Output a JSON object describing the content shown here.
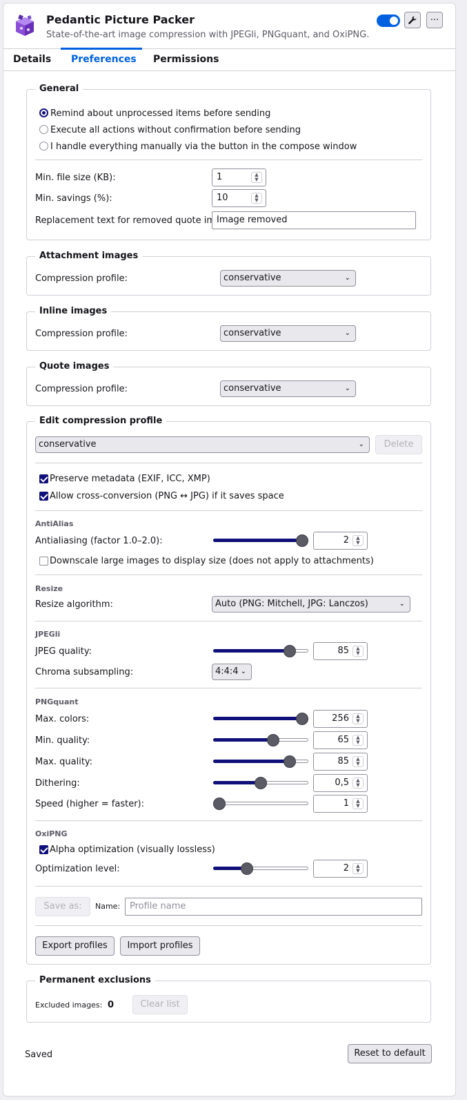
{
  "header": {
    "title": "Pedantic Picture Packer",
    "description": "State-of-the-art image compression with JPEGli, PNGquant, and OxiPNG.",
    "enabled": true,
    "settings_icon": "wrench-icon",
    "more_icon": "ellipsis-icon",
    "more_label": "···"
  },
  "tabs": [
    {
      "label": "Details"
    },
    {
      "label": "Preferences",
      "active": true
    },
    {
      "label": "Permissions"
    }
  ],
  "general": {
    "legend": "General",
    "options": [
      {
        "label": "Remind about unprocessed items before sending",
        "selected": true
      },
      {
        "label": "Execute all actions without confirmation before sending",
        "selected": false
      },
      {
        "label": "I handle everything manually via the button in the compose window",
        "selected": false
      }
    ],
    "min_file_size_label": "Min. file size (KB):",
    "min_file_size": "1",
    "min_savings_label": "Min. savings (%):",
    "min_savings": "10",
    "replacement_label": "Replacement text for removed quote images:",
    "replacement_text": "Image removed"
  },
  "attachment": {
    "legend": "Attachment images",
    "label": "Compression profile:",
    "value": "conservative"
  },
  "inline": {
    "legend": "Inline images",
    "label": "Compression profile:",
    "value": "conservative"
  },
  "quote": {
    "legend": "Quote images",
    "label": "Compression profile:",
    "value": "conservative"
  },
  "edit": {
    "legend": "Edit compression profile",
    "profile": "conservative",
    "delete_label": "Delete",
    "preserve_metadata": "Preserve metadata (EXIF, ICC, XMP)",
    "cross_conversion": "Allow cross-conversion (PNG ↔ JPG) if it saves space",
    "antialias": {
      "heading": "AntiAlias",
      "label": "Antialiasing (factor 1.0–2.0):",
      "value": "2",
      "fraction": 1.0,
      "downscale": "Downscale large images to display size (does not apply to attachments)"
    },
    "resize": {
      "heading": "Resize",
      "label": "Resize algorithm:",
      "value": "Auto (PNG: Mitchell, JPG: Lanczos)"
    },
    "jpegli": {
      "heading": "JPEGli",
      "quality_label": "JPEG quality:",
      "quality": "85",
      "quality_fraction": 0.85,
      "chroma_label": "Chroma subsampling:",
      "chroma": "4:4:4"
    },
    "pngquant": {
      "heading": "PNGquant",
      "rows": [
        {
          "label": "Max. colors:",
          "value": "256",
          "fraction": 1.0
        },
        {
          "label": "Min. quality:",
          "value": "65",
          "fraction": 0.65
        },
        {
          "label": "Max. quality:",
          "value": "85",
          "fraction": 0.85
        },
        {
          "label": "Dithering:",
          "value": "0,5",
          "fraction": 0.5
        },
        {
          "label": "Speed (higher = faster):",
          "value": "1",
          "fraction": 0.0
        }
      ]
    },
    "oxipng": {
      "heading": "OxiPNG",
      "alpha": "Alpha optimization (visually lossless)",
      "level_label": "Optimization level:",
      "level": "2",
      "level_fraction": 0.33
    },
    "save_as_label": "Save as:",
    "name_label": "Name:",
    "name_placeholder": "Profile name",
    "export_label": "Export profiles",
    "import_label": "Import profiles"
  },
  "exclusions": {
    "legend": "Permanent exclusions",
    "label": "Excluded images:",
    "count": "0",
    "clear_label": "Clear list"
  },
  "footer": {
    "status": "Saved",
    "reset_label": "Reset to default"
  },
  "colors": {
    "accent": "#0061e0",
    "slider_fill": "#0f0f7a"
  }
}
